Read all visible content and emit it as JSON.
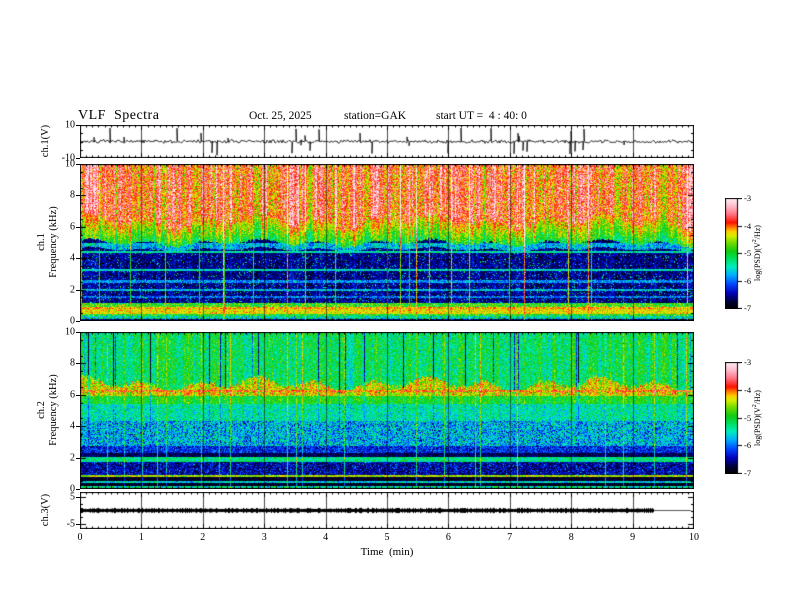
{
  "header": {
    "title": "VLF  Spectra",
    "date": "Oct. 25, 2025",
    "station": "station=GAK",
    "start_ut": "start UT =  4 : 40: 0"
  },
  "time_axis": {
    "label": "Time  (min)",
    "range": [
      0,
      10
    ],
    "ticks": [
      0,
      1,
      2,
      3,
      4,
      5,
      6,
      7,
      8,
      9,
      10
    ],
    "minor_step": 0.1
  },
  "colorbar": {
    "label_pre": "log(PSD)(V",
    "label_sup": "2",
    "label_post": "/Hz)",
    "range": [
      -7,
      -3
    ],
    "ticks": [
      -3,
      -4,
      -5,
      -6,
      -7
    ],
    "stops": [
      {
        "t": 0.0,
        "c": "#000000"
      },
      {
        "t": 0.06,
        "c": "#000033"
      },
      {
        "t": 0.14,
        "c": "#0000bb"
      },
      {
        "t": 0.22,
        "c": "#0044ff"
      },
      {
        "t": 0.3,
        "c": "#00aaff"
      },
      {
        "t": 0.38,
        "c": "#00eebb"
      },
      {
        "t": 0.46,
        "c": "#00dd55"
      },
      {
        "t": 0.52,
        "c": "#11cc11"
      },
      {
        "t": 0.6,
        "c": "#77dd00"
      },
      {
        "t": 0.66,
        "c": "#d8ee00"
      },
      {
        "t": 0.7,
        "c": "#ffcc00"
      },
      {
        "t": 0.74,
        "c": "#ff7700"
      },
      {
        "t": 0.78,
        "c": "#ff1100"
      },
      {
        "t": 0.86,
        "c": "#ff7788"
      },
      {
        "t": 0.93,
        "c": "#ffbbcc"
      },
      {
        "t": 1.0,
        "c": "#ffeef2"
      }
    ]
  },
  "chart_data": {
    "type": "heatmap",
    "title": "VLF Spectra, Oct. 25 2025, station GAK, start UT 4:40:0",
    "xlabel": "Time  (min)",
    "x_range": [
      0,
      10
    ],
    "value_unit": "log(PSD)(V2/Hz)",
    "value_range": [
      -7,
      -3
    ],
    "panels": [
      {
        "id": "ch1_wave",
        "type": "line",
        "ylabel": "ch.1(V)",
        "yticks": [
          10,
          -10
        ],
        "ylim": [
          -10,
          10
        ],
        "signal": {
          "kind": "noise",
          "std": 0.75,
          "spike_prob": 0.05,
          "spike_min": 2,
          "spike_max": 8.5
        },
        "description": "broadband noisy voltage trace centered on 0 V with impulsive spikes to about +/-9 V"
      },
      {
        "id": "ch1_spec",
        "type": "heatmap",
        "ylabel_ch": "ch.1",
        "ylabel": "Frequency  (kHz)",
        "yticks": [
          10,
          8,
          6,
          4,
          2,
          0
        ],
        "ylim": [
          0,
          10
        ],
        "bands": [
          {
            "f": [
              6.35,
              10.0
            ],
            "v": -3.85,
            "noise": 0.45,
            "stripe": 0.6,
            "streak": 0.5,
            "dark": 0,
            "shift_lo": 1
          },
          {
            "f": [
              5.0,
              6.35
            ],
            "v": -5.05,
            "grad_top": -4.15,
            "noise": 0.35,
            "stripe": 0.45,
            "streak": 0.8,
            "dark": 0,
            "shift_hi": 1,
            "shift_lo": 0.5
          },
          {
            "f": [
              4.6,
              5.0
            ],
            "v": -5.7,
            "noise": 0.4,
            "stripe": 0.2,
            "streak": 1.0,
            "dark": 0,
            "shift_lo": 0.3
          },
          {
            "f": [
              1.15,
              4.6
            ],
            "v": -6.55,
            "noise": 0.3,
            "stripe": 0.12,
            "streak": 1.4,
            "dark": 0,
            "speckle_p": 0.05,
            "speckle_v": -5.35
          },
          {
            "f": [
              0.95,
              1.15
            ],
            "v": -4.85,
            "noise": 0.5,
            "streak": 0.35,
            "dark": 0
          },
          {
            "f": [
              0.82,
              0.95
            ],
            "v": -4.15,
            "noise": 0.3,
            "streak": 0.25,
            "dark": 0
          },
          {
            "f": [
              0.5,
              0.82
            ],
            "v": -4.3,
            "noise": 0.25,
            "streak": 0.25,
            "dark": 0
          },
          {
            "f": [
              0.32,
              0.5
            ],
            "v": -5.0,
            "noise": 0.45,
            "streak": 0.35,
            "dark": 0
          },
          {
            "f": [
              0.14,
              0.32
            ],
            "v": -5.5,
            "noise": 0.45,
            "streak": 0.35,
            "dark": 0,
            "speckle_p": 0.1,
            "speckle_v": -4.9
          },
          {
            "f": [
              0.0,
              0.14
            ],
            "v": -6.6,
            "noise": 0.3,
            "streak": 0.5,
            "dark": 0
          }
        ],
        "hlines": [
          {
            "f": 4.45,
            "v": -5.45,
            "noise": 0.35
          },
          {
            "f": 3.3,
            "v": -5.5,
            "noise": 0.35
          },
          {
            "f": 2.55,
            "v": -5.9,
            "noise": 0.4
          },
          {
            "f": 2.0,
            "v": -5.7,
            "noise": 0.45
          },
          {
            "f": 1.55,
            "v": -6.0,
            "noise": 0.45
          }
        ],
        "streaks": {
          "bright_prob": 0.05,
          "bright_min": 0.9,
          "bright_max": 2.4,
          "dark_prob": 0,
          "dark_min": 0,
          "dark_max": 0
        },
        "description": "intense red/orange hiss above ~6.3 kHz with vertical striping, dark blue 1.2-4.6 kHz with cyan speckle and faint horizontal lines, bright yellow band near 0.5-1 kHz, vertical sferic streaks"
      },
      {
        "id": "ch2_spec",
        "type": "heatmap",
        "ylabel_ch": "ch.2",
        "ylabel": "Frequency  (kHz)",
        "yticks": [
          10,
          8,
          6,
          4,
          2,
          0
        ],
        "ylim": [
          0,
          10
        ],
        "bands": [
          {
            "f": [
              6.7,
              10.0
            ],
            "v": -5.15,
            "noise": 0.35,
            "stripe": 0.3,
            "streak": 0.5,
            "dark": 1.0,
            "shift_lo": 1
          },
          {
            "f": [
              5.95,
              6.7
            ],
            "v": -4.35,
            "noise": 0.4,
            "stripe": 0.25,
            "streak": 0.4,
            "dark": 0.5,
            "shift_hi": 1
          },
          {
            "f": [
              5.45,
              5.95
            ],
            "v": -4.95,
            "noise": 0.3,
            "stripe": 0.2,
            "streak": 0.4,
            "dark": 0.4
          },
          {
            "f": [
              4.35,
              5.45
            ],
            "v": -5.4,
            "noise": 0.35,
            "stripe": 0.15,
            "streak": 0.5,
            "dark": 0.3
          },
          {
            "f": [
              2.8,
              4.35
            ],
            "v": -5.7,
            "noise": 0.5,
            "stripe": 0.1,
            "streak": 0.6,
            "dark": 0.2,
            "speckle_p": 0.06,
            "speckle_v": -6.4
          },
          {
            "f": [
              2.35,
              2.8
            ],
            "v": -6.25,
            "noise": 0.35,
            "streak": 0.7,
            "dark": 0
          },
          {
            "f": [
              2.05,
              2.35
            ],
            "v": -6.7,
            "noise": 0.25,
            "streak": 0.7,
            "dark": 0
          },
          {
            "f": [
              1.75,
              2.05
            ],
            "v": -5.3,
            "noise": 0.35,
            "streak": 0.5,
            "dark": 0
          },
          {
            "f": [
              0.95,
              1.75
            ],
            "v": -6.5,
            "noise": 0.35,
            "streak": 0.8,
            "dark": 0,
            "speckle_p": 0.05,
            "speckle_v": -5.9
          },
          {
            "f": [
              0.78,
              0.95
            ],
            "v": -4.5,
            "noise": 0.35,
            "streak": 0.2,
            "dark": 0
          },
          {
            "f": [
              0.55,
              0.78
            ],
            "v": -6.85,
            "noise": 0.15,
            "streak": 0.6,
            "dark": 0
          },
          {
            "f": [
              0.42,
              0.55
            ],
            "v": -5.6,
            "noise": 0.4,
            "streak": 0.4,
            "dark": 0
          },
          {
            "f": [
              0.22,
              0.42
            ],
            "v": -6.85,
            "noise": 0.15,
            "streak": 0.6,
            "dark": 0
          },
          {
            "f": [
              0.1,
              0.22
            ],
            "v": -5.4,
            "noise": 0.5,
            "streak": 0.4,
            "dark": 0
          },
          {
            "f": [
              0.0,
              0.1
            ],
            "v": -6.9,
            "noise": 0.1,
            "streak": 0.5,
            "dark": 0
          }
        ],
        "hlines": [
          {
            "f": 6.25,
            "v": -4.05,
            "noise": 0.5
          }
        ],
        "streaks": {
          "bright_prob": 0.04,
          "bright_min": 0.8,
          "bright_max": 1.8,
          "dark_prob": 0.06,
          "dark_min": 0.8,
          "dark_max": 1.6
        },
        "description": "green/cyan background with dark vertical streaks, bright yellow-red hiss band near 6-6.5 kHz, blue bands 1-2.5 kHz, thin red line near 0.8 kHz, vertical sferic streaks"
      },
      {
        "id": "ch3_wave",
        "type": "line",
        "ylabel": "ch.3(V)",
        "yticks": [
          5,
          -5
        ],
        "ylim": [
          -6.85,
          6.85
        ],
        "signal": {
          "kind": "flat",
          "value": 0,
          "thick_end_min": 9.35,
          "thin_end_min": 9.95
        },
        "description": "constant 0 V thick trace ending near 9.35 min, thin line continues to ~9.95 min"
      }
    ]
  }
}
